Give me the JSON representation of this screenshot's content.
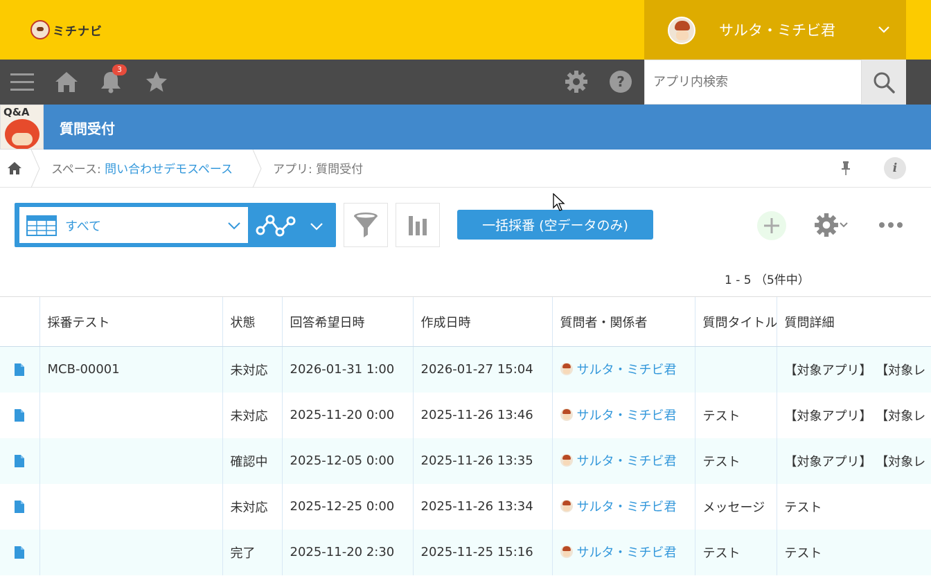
{
  "header": {
    "logo_text": "ミチナビ",
    "user_name": "サルタ・ミチビ君"
  },
  "nav": {
    "notification_count": "3",
    "search_placeholder": "アプリ内検索"
  },
  "app": {
    "icon_text": "Q&A",
    "title": "質問受付"
  },
  "breadcrumb": {
    "space_prefix": "スペース: ",
    "space_name": "問い合わせデモスペース",
    "app_label": "アプリ: 質問受付"
  },
  "toolbar": {
    "view_label": "すべて",
    "action_label": "一括採番 (空データのみ)",
    "info_glyph": "i"
  },
  "pagination": {
    "range_text": "1 - 5 （5件中）"
  },
  "table": {
    "columns": [
      "",
      "採番テスト",
      "状態",
      "回答希望日時",
      "作成日時",
      "質問者・関係者",
      "質問タイトル",
      "質問詳細"
    ],
    "rows": [
      {
        "number": "MCB-00001",
        "status": "未対応",
        "desired": "2026-01-31 1:00",
        "created": "2026-01-27 15:04",
        "person": "サルタ・ミチビ君",
        "title": "",
        "detail": "【対象アプリ】 【対象レ"
      },
      {
        "number": "",
        "status": "未対応",
        "desired": "2025-11-20 0:00",
        "created": "2025-11-26 13:46",
        "person": "サルタ・ミチビ君",
        "title": "テスト",
        "detail": "【対象アプリ】 【対象レ"
      },
      {
        "number": "",
        "status": "確認中",
        "desired": "2025-12-05 0:00",
        "created": "2025-11-26 13:35",
        "person": "サルタ・ミチビ君",
        "title": "テスト",
        "detail": "【対象アプリ】 【対象レ"
      },
      {
        "number": "",
        "status": "未対応",
        "desired": "2025-12-25 0:00",
        "created": "2025-11-26 13:34",
        "person": "サルタ・ミチビ君",
        "title": "メッセージ",
        "detail": "テスト"
      },
      {
        "number": "",
        "status": "完了",
        "desired": "2025-11-20 2:30",
        "created": "2025-11-25 15:16",
        "person": "サルタ・ミチビ君",
        "title": "テスト",
        "detail": "テスト"
      }
    ]
  },
  "colors": {
    "header_yellow": "#fccb00",
    "user_panel": "#deac00",
    "nav_dark": "#4a4a4a",
    "app_blue": "#4189cc",
    "accent_blue": "#3498db",
    "row_tint": "#f2fdfd"
  },
  "icons": [
    "menu-icon",
    "home-icon",
    "bell-icon",
    "star-icon",
    "gear-icon",
    "help-icon",
    "search-icon",
    "pin-icon",
    "info-icon",
    "table-icon",
    "graph-icon",
    "filter-icon",
    "bar-chart-icon",
    "plus-icon",
    "more-icon",
    "document-icon"
  ]
}
